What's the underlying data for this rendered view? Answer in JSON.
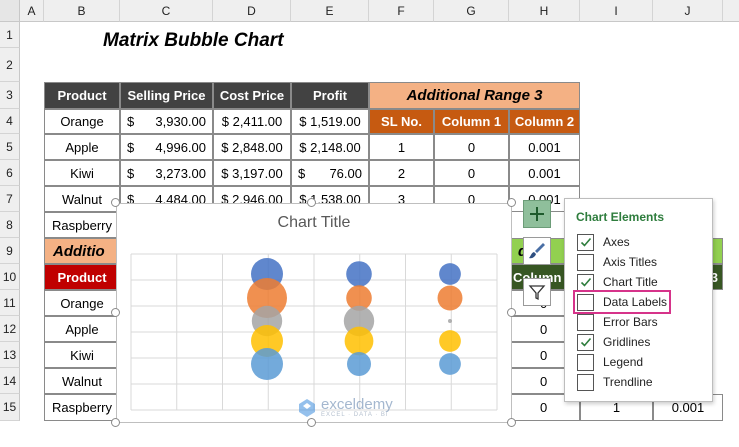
{
  "columns": [
    "A",
    "B",
    "C",
    "D",
    "E",
    "F",
    "G",
    "H",
    "I",
    "J"
  ],
  "rows": [
    "1",
    "2",
    "3",
    "4",
    "5",
    "6",
    "7",
    "8",
    "9",
    "10",
    "11",
    "12",
    "13",
    "14",
    "15"
  ],
  "sheet_title": "Matrix Bubble Chart",
  "table1": {
    "headers": [
      "Product",
      "Selling Price",
      "Cost Price",
      "Profit"
    ],
    "rows": [
      {
        "product": "Orange",
        "sell_sym": "$",
        "sell": "3,930.00",
        "cost": "$ 2,411.00",
        "profit": "$ 1,519.00"
      },
      {
        "product": "Apple",
        "sell_sym": "$",
        "sell": "4,996.00",
        "cost": "$ 2,848.00",
        "profit": "$ 2,148.00"
      },
      {
        "product": "Kiwi",
        "sell_sym": "$",
        "sell": "3,273.00",
        "cost": "$ 3,197.00",
        "profit_sym": "$",
        "profit": "76.00"
      },
      {
        "product": "Walnut",
        "sell_sym": "$",
        "sell": "4,484.00",
        "cost": "$ 2,946.00",
        "profit": "$ 1,538.00"
      },
      {
        "product": "Raspberry"
      }
    ]
  },
  "range3": {
    "title": "Additional Range 3",
    "headers": [
      "SL No.",
      "Column 1",
      "Column 2"
    ],
    "rows": [
      [
        "1",
        "0",
        "0.001"
      ],
      [
        "2",
        "0",
        "0.001"
      ],
      [
        "3",
        "0",
        "0.001"
      ]
    ]
  },
  "lower": {
    "title_partial": "Additio",
    "header_product": "Product",
    "products": [
      "Orange",
      "Apple",
      "Kiwi",
      "Walnut",
      "Raspberry"
    ],
    "h_green_partial": "d",
    "h_col_partial": "Column",
    "j10": "3",
    "h_values": [
      "0",
      "0",
      "0",
      "0",
      "0"
    ],
    "i15": "1",
    "j15": "0.001"
  },
  "chart": {
    "title": "Chart Title",
    "colors": {
      "blue": "#4472c4",
      "orange": "#ed7d31",
      "gray": "#a5a5a5",
      "yellow": "#ffc000",
      "lightblue": "#5b9bd5"
    }
  },
  "chart_data": {
    "type": "bubble",
    "title": "Chart Title",
    "xlabel": "",
    "ylabel": "",
    "series_order": [
      "Orange",
      "Apple",
      "Kiwi",
      "Walnut",
      "Raspberry"
    ],
    "columns": [
      1,
      2,
      3
    ],
    "bubbles": [
      {
        "series": 0,
        "col": 1,
        "size": 1
      },
      {
        "series": 1,
        "col": 1,
        "size": 1.25
      },
      {
        "series": 2,
        "col": 1,
        "size": 0.95
      },
      {
        "series": 3,
        "col": 1,
        "size": 1
      },
      {
        "series": 4,
        "col": 1,
        "size": 1
      },
      {
        "series": 0,
        "col": 2,
        "size": 0.8
      },
      {
        "series": 1,
        "col": 2,
        "size": 0.8
      },
      {
        "series": 2,
        "col": 2,
        "size": 0.95
      },
      {
        "series": 3,
        "col": 2,
        "size": 0.9
      },
      {
        "series": 4,
        "col": 2,
        "size": 0.75
      },
      {
        "series": 0,
        "col": 3,
        "size": 0.68
      },
      {
        "series": 1,
        "col": 3,
        "size": 0.78
      },
      {
        "series": 2,
        "col": 3,
        "size": 0.1
      },
      {
        "series": 3,
        "col": 3,
        "size": 0.68
      },
      {
        "series": 4,
        "col": 3,
        "size": 0.68
      }
    ]
  },
  "chart_elements": {
    "title": "Chart Elements",
    "items": [
      {
        "label": "Axes",
        "checked": true
      },
      {
        "label": "Axis Titles",
        "checked": false
      },
      {
        "label": "Chart Title",
        "checked": true
      },
      {
        "label": "Data Labels",
        "checked": false,
        "highlighted": true
      },
      {
        "label": "Error Bars",
        "checked": false
      },
      {
        "label": "Gridlines",
        "checked": true
      },
      {
        "label": "Legend",
        "checked": false
      },
      {
        "label": "Trendline",
        "checked": false
      }
    ]
  },
  "watermark": {
    "name": "exceldemy",
    "tagline": "EXCEL · DATA · BI"
  }
}
